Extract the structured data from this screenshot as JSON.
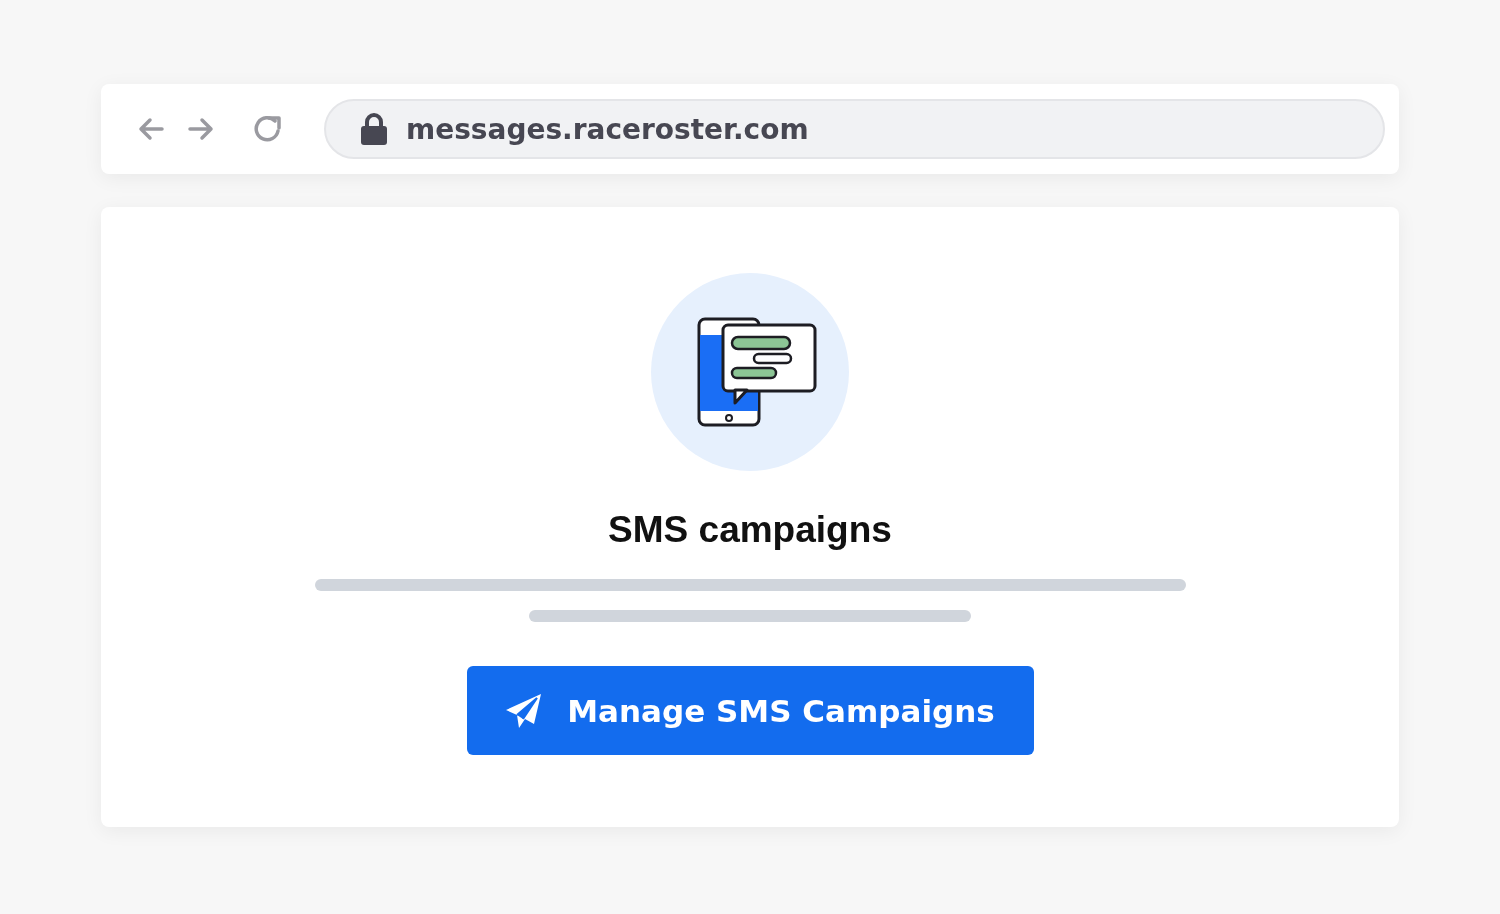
{
  "browser": {
    "url": "messages.raceroster.com"
  },
  "card": {
    "title": "SMS campaigns",
    "button": "Manage SMS Campaigns"
  }
}
